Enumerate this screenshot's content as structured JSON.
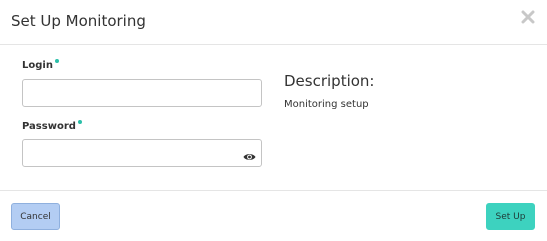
{
  "dialog": {
    "title": "Set Up Monitoring",
    "close_icon": "close-icon"
  },
  "form": {
    "login": {
      "label": "Login",
      "value": "",
      "required": true
    },
    "password": {
      "label": "Password",
      "value": "",
      "required": true,
      "toggle_icon": "eye-icon"
    }
  },
  "description": {
    "heading": "Description:",
    "text": "Monitoring setup"
  },
  "footer": {
    "cancel_label": "Cancel",
    "setup_label": "Set Up"
  },
  "colors": {
    "required_dot": "#2bbfa9",
    "cancel_button": "#b3cdf3",
    "setup_button": "#3dd2bf"
  }
}
